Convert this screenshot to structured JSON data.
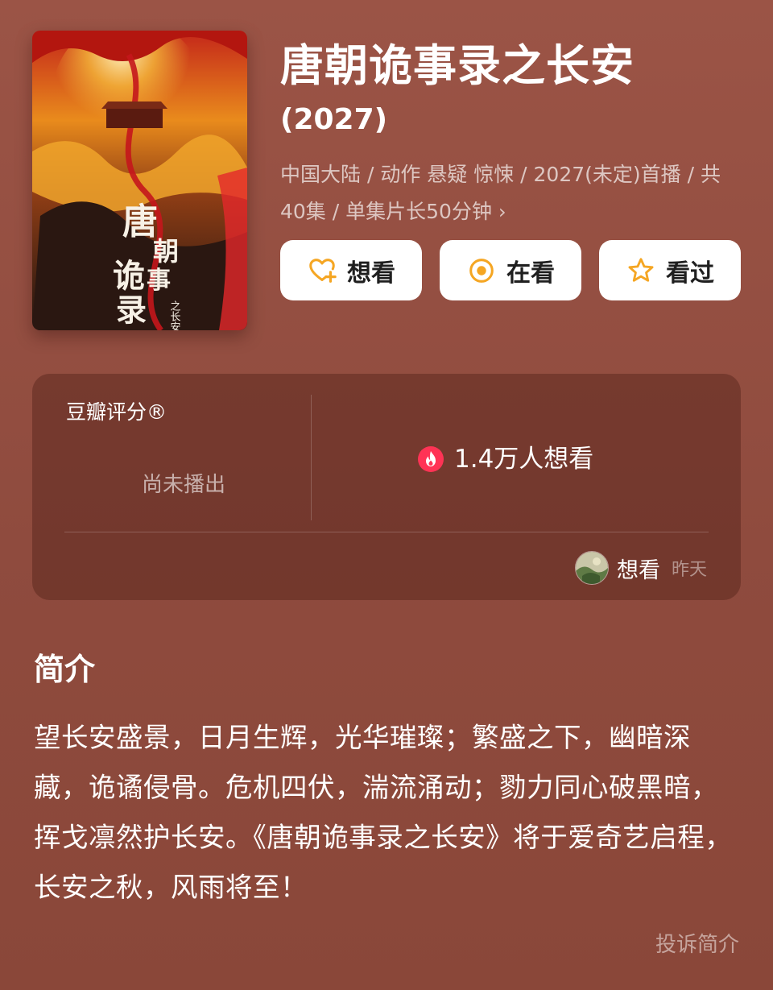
{
  "title": "唐朝诡事录之长安",
  "year": "(2027)",
  "meta": "中国大陆 / 动作 悬疑 惊悚 / 2027(未定)首播 / 共40集 / 单集片长50分钟",
  "meta_arrow": "›",
  "poster": {
    "calligraphy": "唐朝诡事录",
    "subtitle": "之长安"
  },
  "actions": [
    {
      "label": "想看",
      "icon": "heart-plus-icon"
    },
    {
      "label": "在看",
      "icon": "target-circle-icon"
    },
    {
      "label": "看过",
      "icon": "star-icon"
    }
  ],
  "rating": {
    "label": "豆瓣评分®",
    "status": "尚未播出",
    "wish_count": "1.4万人想看",
    "wish_icon": "fire-icon",
    "activity": {
      "action": "想看",
      "time": "昨天"
    }
  },
  "synopsis": {
    "title": "简介",
    "text": "望长安盛景，日月生辉，光华璀璨；繁盛之下，幽暗深藏，诡谲侵骨。危机四伏，湍流涌动；勠力同心破黑暗，挥戈凛然护长安。《唐朝诡事录之长安》将于爱奇艺启程，长安之秋，风雨将至！",
    "report_label": "投诉简介"
  },
  "colors": {
    "background": "#9b5446",
    "accent": "#f5a623",
    "fire": "#ff3355"
  }
}
